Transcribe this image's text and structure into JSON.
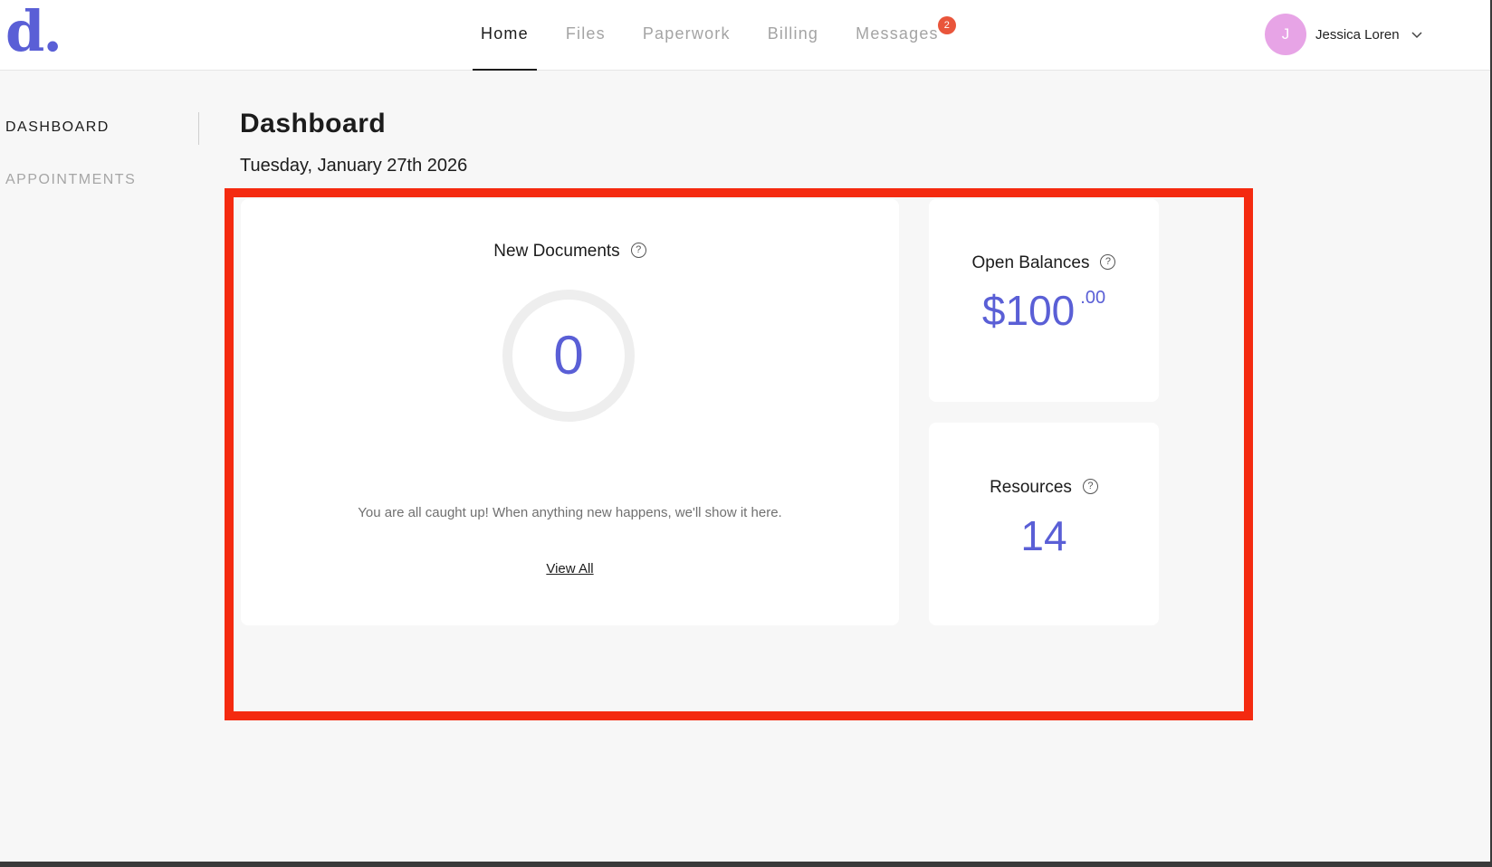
{
  "brand": {
    "logo_text": "d.",
    "accent_color": "#5a5fd6"
  },
  "nav": {
    "tabs": [
      {
        "label": "Home",
        "active": true
      },
      {
        "label": "Files",
        "active": false
      },
      {
        "label": "Paperwork",
        "active": false
      },
      {
        "label": "Billing",
        "active": false
      },
      {
        "label": "Messages",
        "active": false,
        "badge": "2"
      }
    ]
  },
  "user": {
    "initial": "J",
    "name": "Jessica Loren",
    "avatar_color": "#e7a4e6"
  },
  "sidebar": {
    "items": [
      {
        "label": "DASHBOARD",
        "active": true
      },
      {
        "label": "APPOINTMENTS",
        "active": false
      }
    ]
  },
  "page": {
    "title": "Dashboard",
    "date": "Tuesday, January 27th 2026"
  },
  "cards": {
    "new_documents": {
      "title": "New Documents",
      "count": "0",
      "message": "You are all caught up! When anything new happens, we'll show it here.",
      "link": "View All"
    },
    "open_balances": {
      "title": "Open Balances",
      "amount": "$100",
      "cents": ".00"
    },
    "resources": {
      "title": "Resources",
      "count": "14"
    }
  },
  "icons": {
    "help": "?"
  },
  "highlight_color": "#f42a10"
}
